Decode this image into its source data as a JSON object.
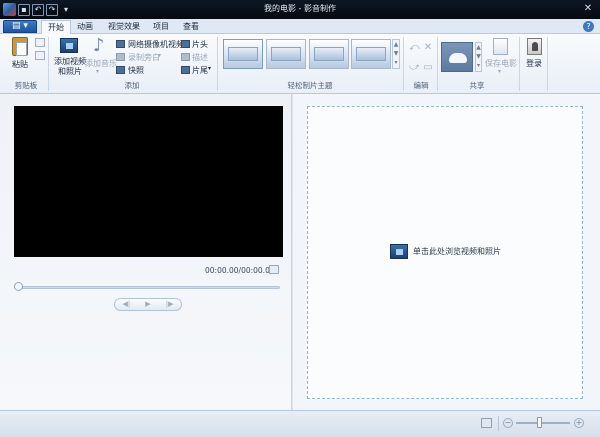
{
  "window": {
    "title": "我的电影 - 影音制作"
  },
  "tabs": [
    {
      "label": "开始",
      "active": true
    },
    {
      "label": "动画",
      "active": false
    },
    {
      "label": "视觉效果",
      "active": false
    },
    {
      "label": "项目",
      "active": false
    },
    {
      "label": "查看",
      "active": false
    }
  ],
  "ribbon": {
    "clipboard": {
      "paste": "粘贴",
      "group": "剪贴板"
    },
    "add": {
      "add_videos_line1": "添加视频",
      "add_videos_line2": "和照片",
      "add_music": "添加音乐",
      "webcam": "网络摄像机视频",
      "narration": "录制旁白",
      "snapshot": "快照",
      "title": "片头",
      "caption": "描述",
      "credits": "片尾",
      "group": "添加"
    },
    "themes": {
      "group": "轻松制片主题"
    },
    "editing": {
      "group": "编辑"
    },
    "sharing": {
      "save_movie": "保存电影",
      "group": "共享"
    },
    "sign_in": "登录"
  },
  "preview": {
    "timecode": "00:00.00/00:00.00"
  },
  "storyboard": {
    "hint": "单击此处浏览视频和照片"
  },
  "colors": {
    "accent": "#1e56a0",
    "titlebar": "#0b1420"
  }
}
